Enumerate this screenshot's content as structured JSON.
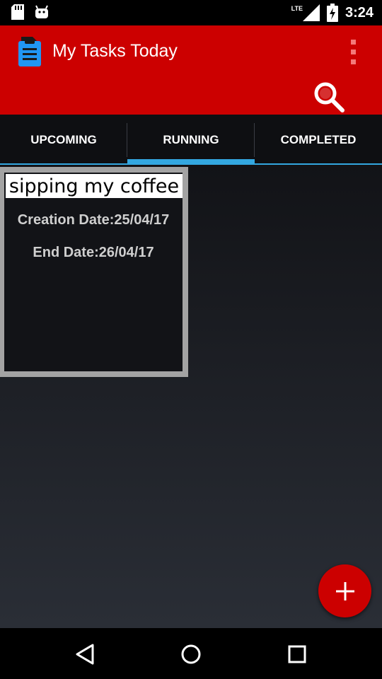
{
  "status_bar": {
    "network": "LTE",
    "time": "3:24"
  },
  "app_bar": {
    "title": "My Tasks Today",
    "accent_color": "#cc0000"
  },
  "tabs": [
    {
      "label": "UPCOMING",
      "selected": false
    },
    {
      "label": "RUNNING",
      "selected": true
    },
    {
      "label": "COMPLETED",
      "selected": false
    }
  ],
  "tab_indicator_color": "#33a7e0",
  "tasks": [
    {
      "title": "sipping my coffee",
      "creation": "Creation Date:25/04/17",
      "end": "End Date:26/04/17"
    }
  ],
  "fab": {
    "label": "+",
    "icon": "add-icon"
  },
  "nav": [
    "back-icon",
    "home-icon",
    "recents-icon"
  ]
}
